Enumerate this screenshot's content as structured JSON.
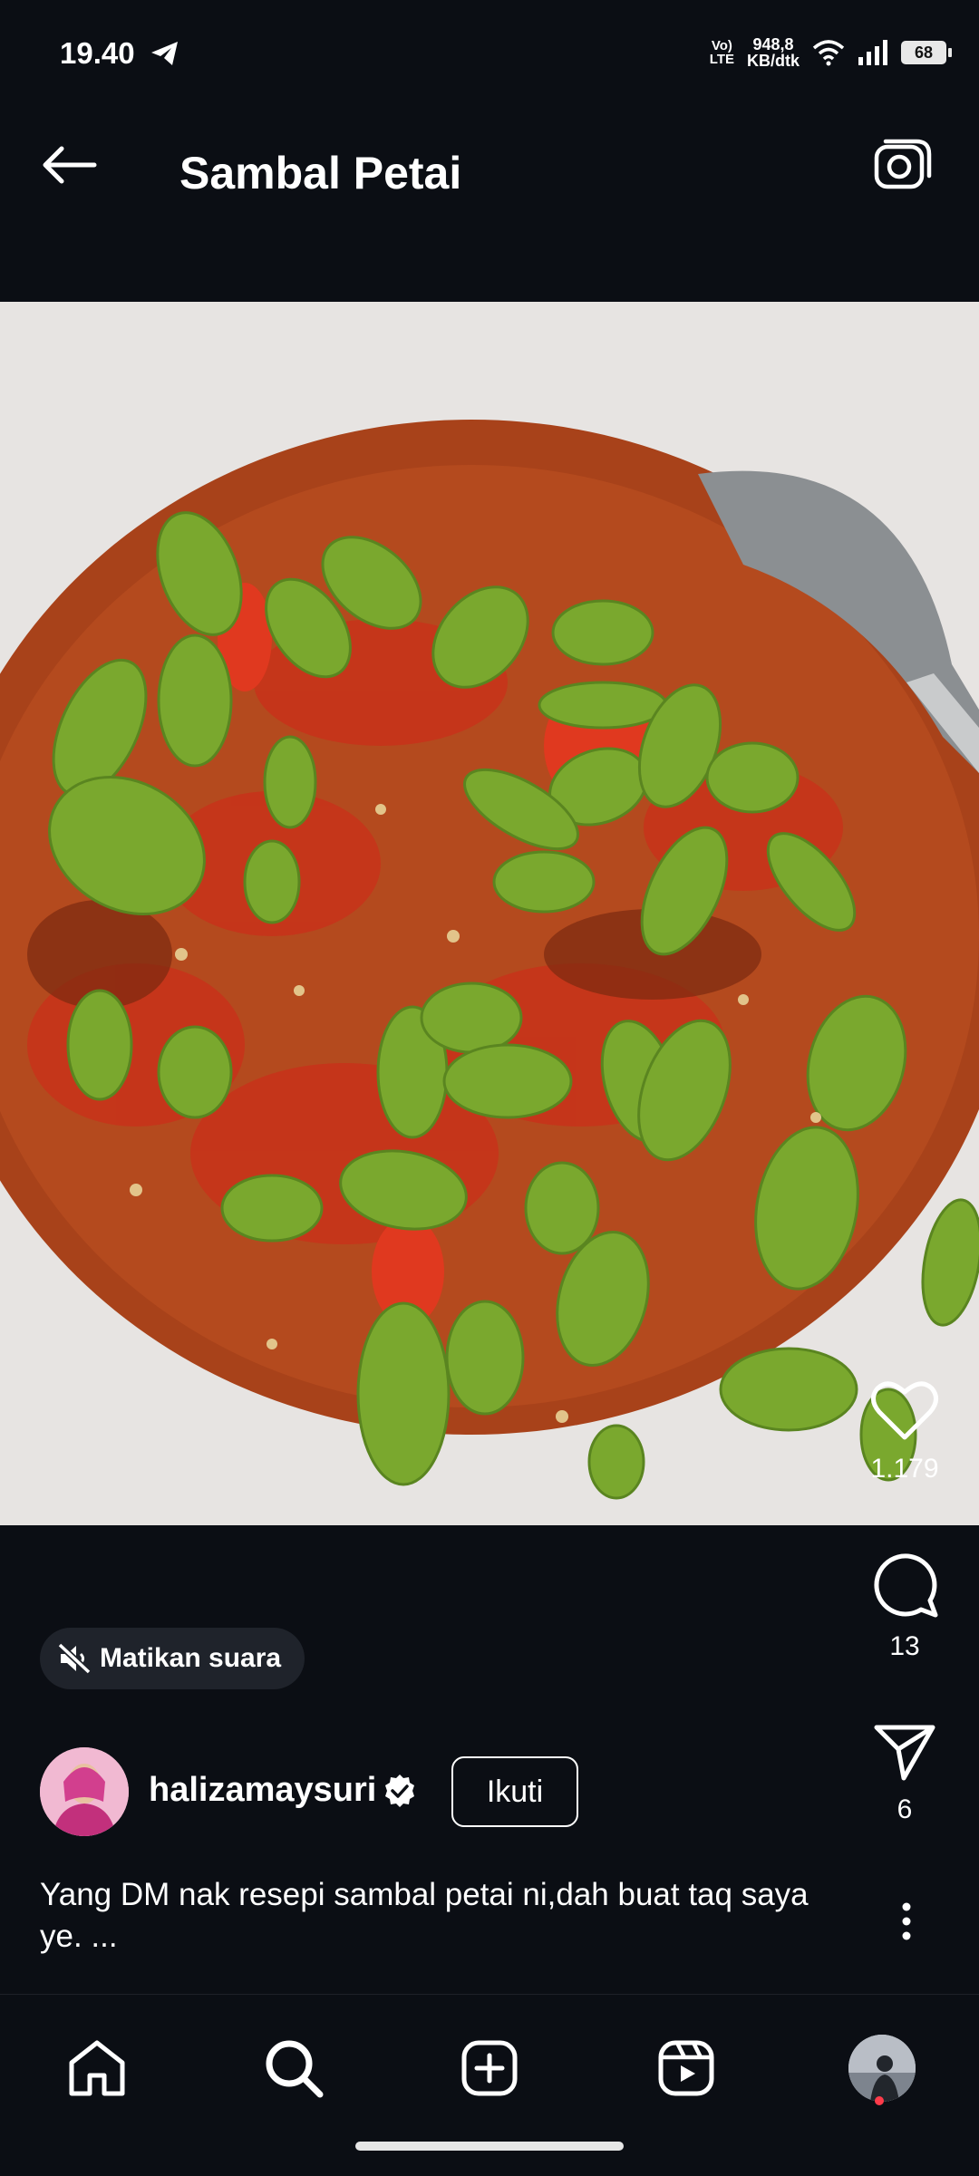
{
  "status_bar": {
    "time": "19.40",
    "volte_top": "Vo)",
    "volte_bottom": "LTE",
    "net_speed_value": "948,8",
    "net_speed_unit": "KB/dtk",
    "battery": "68",
    "icons": [
      "telegram-icon",
      "wifi-icon",
      "signal-icon",
      "battery-icon"
    ]
  },
  "header": {
    "title": "Sambal Petai",
    "back_icon": "arrow-left-icon",
    "camera_icon": "camera-icon"
  },
  "media": {
    "subject": "sambal-petai-photo"
  },
  "actions": {
    "likes": "1.179",
    "comments": "13",
    "shares": "6"
  },
  "mute": {
    "label": "Matikan suara",
    "icon": "speaker-muted-icon"
  },
  "author": {
    "username": "halizamaysuri",
    "verified": true,
    "follow_label": "Ikuti"
  },
  "caption": {
    "text": "Yang DM nak resepi sambal petai ni,dah buat taq saya ye. ..."
  },
  "bottom_nav": {
    "items": [
      "home-icon",
      "search-icon",
      "create-icon",
      "reels-icon",
      "profile-avatar"
    ]
  },
  "colors": {
    "background": "#0b0e14",
    "pill": "#1f232b",
    "notification_dot": "#ff3b4a"
  }
}
